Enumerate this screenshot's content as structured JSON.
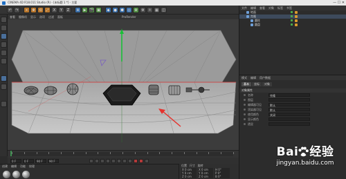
{
  "window": {
    "title": "CINEMA 4D R18.011 Studio (R) - [未标题 1 *] - 主要",
    "controls": "—  ☐  ✕"
  },
  "toolbar": {
    "buttons": [
      "↶",
      "↷",
      "⌖",
      "✥",
      "⟲",
      "⤢",
      "X",
      "Y",
      "Z",
      "⊕",
      "▶",
      "🎬",
      "▣",
      "◆",
      "●",
      "⬢",
      "◎",
      "✿",
      "⚙",
      "☼",
      "▦",
      "◫"
    ]
  },
  "viewport": {
    "menu": [
      "查看",
      "摄像机",
      "显示",
      "选项",
      "过滤",
      "面板"
    ],
    "menu_right": "ProRender"
  },
  "timeline": {
    "start_frame": "0 F",
    "end_frame": "90 F",
    "current": "0 F"
  },
  "transport": {
    "fields": [
      "0 F",
      "0 F",
      "90 F",
      "90 F"
    ]
  },
  "materials": {
    "menu": [
      "创建",
      "编辑",
      "功能",
      "纹理"
    ]
  },
  "coords": {
    "header": [
      "位置",
      "尺寸",
      "旋转"
    ],
    "rows": [
      [
        "X 0 cm",
        "X 0 cm",
        "H 0°"
      ],
      [
        "Y 0 cm",
        "Y 0 cm",
        "P 0°"
      ],
      [
        "Z 0 cm",
        "Z 0 cm",
        "B 0°"
      ]
    ]
  },
  "objects": {
    "menu": [
      "文件",
      "编辑",
      "查看",
      "对象",
      "标签",
      "书签"
    ],
    "items": [
      "地面",
      "克隆",
      "圆柱",
      "圆盘"
    ]
  },
  "attributes": {
    "menu": [
      "模式",
      "编辑",
      "用户数据"
    ],
    "tabs": [
      "基本",
      "坐标",
      "对象"
    ],
    "section": "对象属性",
    "props": [
      {
        "label": "名称",
        "value": "克隆"
      },
      {
        "label": "图层",
        "value": ""
      },
      {
        "label": "编辑器可见",
        "value": "默认"
      },
      {
        "label": "渲染器可见",
        "value": "默认"
      },
      {
        "label": "使用颜色",
        "value": "关闭"
      },
      {
        "label": "显示颜色",
        "value": ""
      },
      {
        "label": "透显",
        "value": ""
      }
    ]
  },
  "watermark": {
    "brand_left": "Bai",
    "brand_right": "经验",
    "url": "jingyan.baidu.com"
  },
  "colors": {
    "accent_blue": "#3a6ea8",
    "axis_green": "#19c037",
    "axis_red": "#e33a3a",
    "arrow_red": "#e5322d"
  }
}
